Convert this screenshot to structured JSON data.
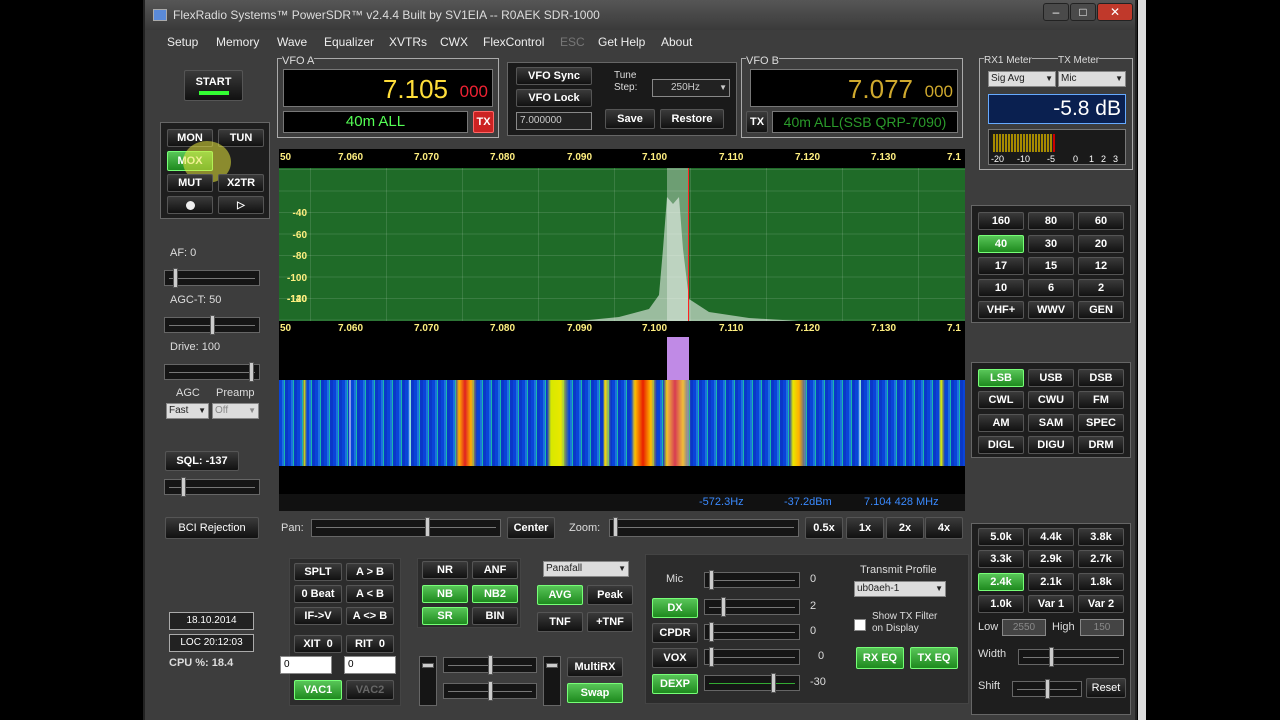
{
  "window": {
    "title": "FlexRadio Systems™  PowerSDR™  v2.4.4   Built by SV1EIA  --  R0AEK   SDR-1000"
  },
  "menu": [
    "Setup",
    "Memory",
    "Wave",
    "Equalizer",
    "XVTRs",
    "CWX",
    "FlexControl",
    "ESC",
    "Get Help",
    "About"
  ],
  "power": {
    "start_label": "START"
  },
  "mon_panel": {
    "mon": "MON",
    "tun": "TUN",
    "mox": "MOX",
    "mut": "MUT",
    "x2tr": "X2TR"
  },
  "controls": {
    "af": "AF:  0",
    "agct": "AGC-T:  50",
    "drive": "Drive:  100",
    "agc": "AGC",
    "preamp": "Preamp",
    "agc_value": "Fast",
    "preamp_value": "Off",
    "sql": "SQL: -137",
    "bci": "BCI Rejection"
  },
  "status": {
    "date": "18.10.2014",
    "time": "LOC 20:12:03",
    "cpu": "CPU %: 18.4"
  },
  "vfoa": {
    "label": "VFO A",
    "freq": "7.105",
    "freq_sub": "000",
    "band": "40m ALL",
    "tx": "TX"
  },
  "vfo_mid": {
    "sync": "VFO Sync",
    "lock": "VFO Lock",
    "tune_step": "Tune\nStep:",
    "step_value": "250Hz",
    "freq_box": "7.000000",
    "save": "Save",
    "restore": "Restore"
  },
  "vfob": {
    "label": "VFO B",
    "freq": "7.077",
    "freq_sub": "000",
    "band": "40m ALL(SSB QRP-7090)",
    "tx": "TX"
  },
  "meter": {
    "rx_label": "RX1 Meter",
    "tx_label": "TX Meter",
    "rx_sel": "Sig Avg",
    "tx_sel": "Mic",
    "value": "-5.8 dB",
    "scale": [
      "-20",
      "-10",
      "-5",
      "0",
      "1",
      "2",
      "3"
    ]
  },
  "spectrum": {
    "freqs": [
      "50",
      "7.060",
      "7.070",
      "7.080",
      "7.090",
      "7.100",
      "7.110",
      "7.120",
      "7.130",
      "7.1"
    ],
    "db": [
      "-40",
      "-60",
      "-80",
      "-100",
      "-120",
      "-140"
    ],
    "readout_hz": "-572.3Hz",
    "readout_dbm": "-37.2dBm",
    "readout_mhz": "7.104 428 MHz"
  },
  "pan": {
    "pan": "Pan:",
    "center": "Center",
    "zoom": "Zoom:",
    "z05": "0.5x",
    "z1": "1x",
    "z2": "2x",
    "z4": "4x"
  },
  "bands": [
    "160",
    "80",
    "60",
    "40",
    "30",
    "20",
    "17",
    "15",
    "12",
    "10",
    "6",
    "2",
    "VHF+",
    "WWV",
    "GEN"
  ],
  "modes": [
    "LSB",
    "USB",
    "DSB",
    "CWL",
    "CWU",
    "FM",
    "AM",
    "SAM",
    "SPEC",
    "DIGL",
    "DIGU",
    "DRM"
  ],
  "filters": [
    "5.0k",
    "4.4k",
    "3.8k",
    "3.3k",
    "2.9k",
    "2.7k",
    "2.4k",
    "2.1k",
    "1.8k",
    "1.0k",
    "Var 1",
    "Var 2"
  ],
  "filter_ctrl": {
    "low": "Low",
    "high": "High",
    "low_val": "2550",
    "high_val": "150",
    "width": "Width",
    "shift": "Shift",
    "reset": "Reset"
  },
  "vfo_ops": {
    "splt": "SPLT",
    "atob": "A > B",
    "zerobeat": "0 Beat",
    "atobl": "A < B",
    "ifv": "IF->V",
    "swap_ab": "A <> B",
    "xit": "XIT",
    "xit_val": "0",
    "rit": "RIT",
    "rit_val": "0",
    "xit_box": "0",
    "rit_box": "0",
    "vac1": "VAC1",
    "vac2": "VAC2"
  },
  "dsp": {
    "nr": "NR",
    "anf": "ANF",
    "nb": "NB",
    "nb2": "NB2",
    "sr": "SR",
    "bin": "BIN",
    "display_mode": "Panafall",
    "avg": "AVG",
    "peak": "Peak",
    "tnf": "TNF",
    "ptnf": "+TNF",
    "multirx": "MultiRX",
    "swap": "Swap"
  },
  "tx_panel": {
    "mic": "Mic",
    "mic_val": "0",
    "dx": "DX",
    "dx_val": "2",
    "cpdr": "CPDR",
    "cpdr_val": "0",
    "vox": "VOX",
    "vox_val": "0",
    "dexp": "DEXP",
    "dexp_val": "-30",
    "profile": "Transmit Profile",
    "profile_val": "ub0aeh-1",
    "show_tx": "Show TX Filter\non Display",
    "rxeq": "RX EQ",
    "txeq": "TX EQ"
  },
  "colors": {
    "active": "#2aa02a",
    "freq": "#ffde3a",
    "band_text": "#54ff54"
  }
}
